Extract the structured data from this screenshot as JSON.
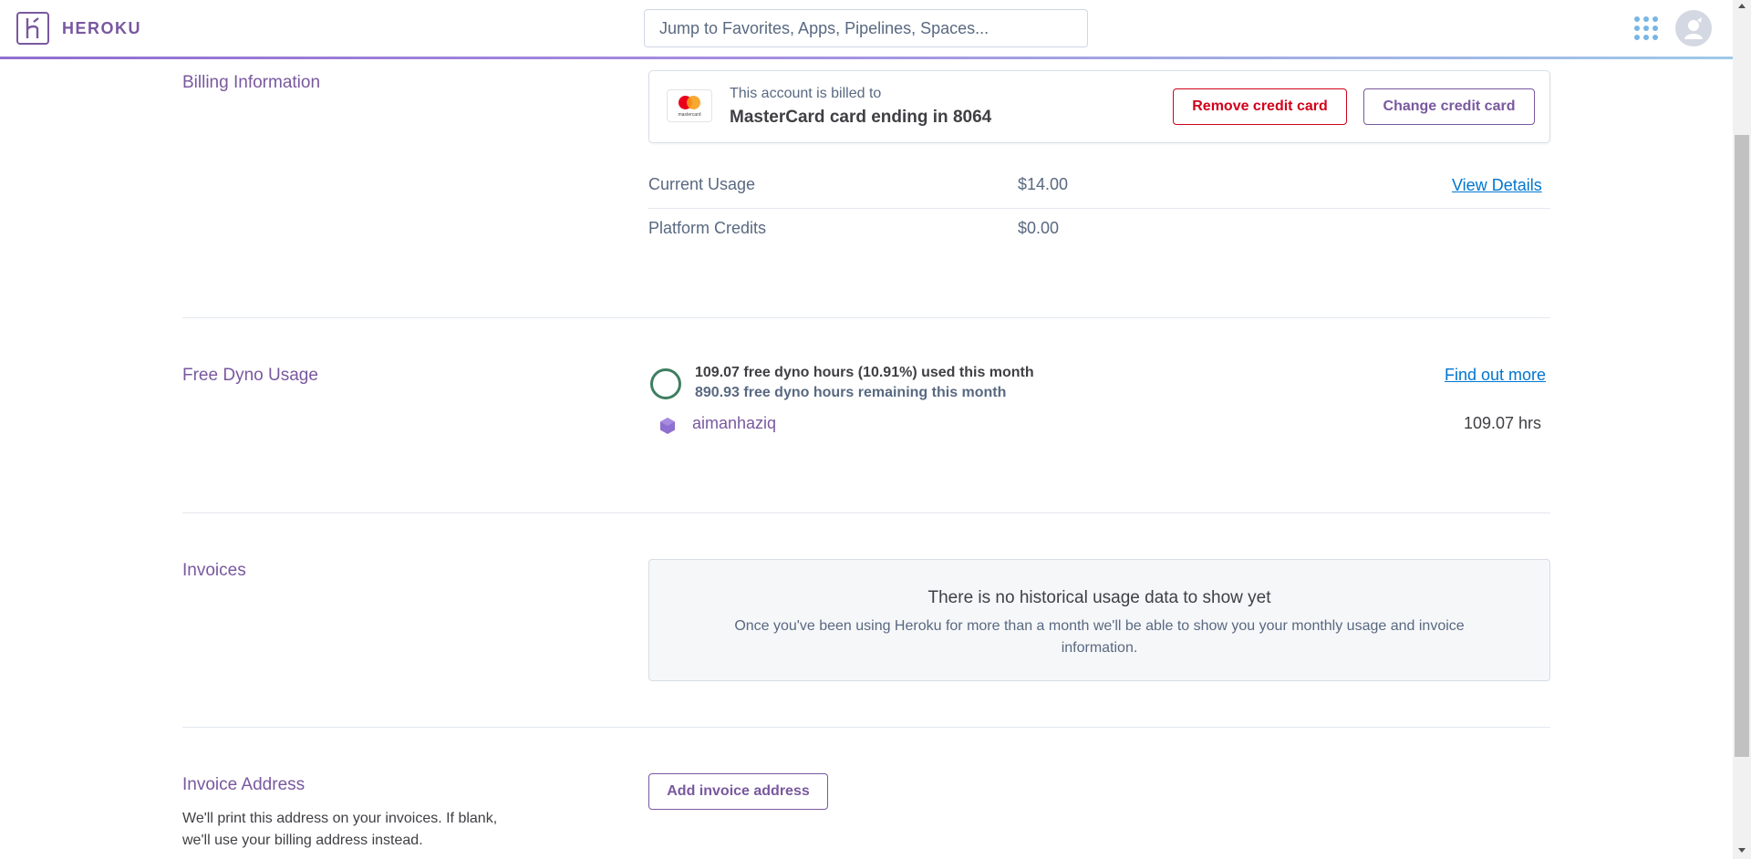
{
  "nav": {
    "logo_text": "HEROKU",
    "search_placeholder": "Jump to Favorites, Apps, Pipelines, Spaces...",
    "apps_icon": "apps-grid-icon",
    "avatar_icon": "user-avatar-icon"
  },
  "billing": {
    "title": "Billing Information",
    "card_sub": "This account is billed to",
    "card_main": "MasterCard card ending in 8064",
    "card_logo_text": "mastercard",
    "remove_label": "Remove credit card",
    "change_label": "Change credit card",
    "rows": [
      {
        "label": "Current Usage",
        "value": "$14.00",
        "link": "View Details"
      },
      {
        "label": "Platform Credits",
        "value": "$0.00"
      }
    ]
  },
  "dyno": {
    "title": "Free Dyno Usage",
    "used_text": "109.07 free dyno hours (10.91%) used this month",
    "remaining_text": "890.93 free dyno hours remaining this month",
    "used_fraction": 0.1091,
    "link": "Find out more",
    "apps": [
      {
        "name": "aimanhaziq",
        "hours": "109.07 hrs"
      }
    ]
  },
  "invoices": {
    "title": "Invoices",
    "empty_title": "There is no historical usage data to show yet",
    "empty_body": "Once you've been using Heroku for more than a month we'll be able to show you your monthly usage and invoice information."
  },
  "invoice_address": {
    "title": "Invoice Address",
    "help": "We'll print this address on your invoices. If blank, we'll use your billing address instead.",
    "add_label": "Add invoice address"
  },
  "colors": {
    "brand": "#79589f",
    "danger": "#d0021b",
    "link": "#0076d1",
    "ring": "#3f7e62"
  }
}
